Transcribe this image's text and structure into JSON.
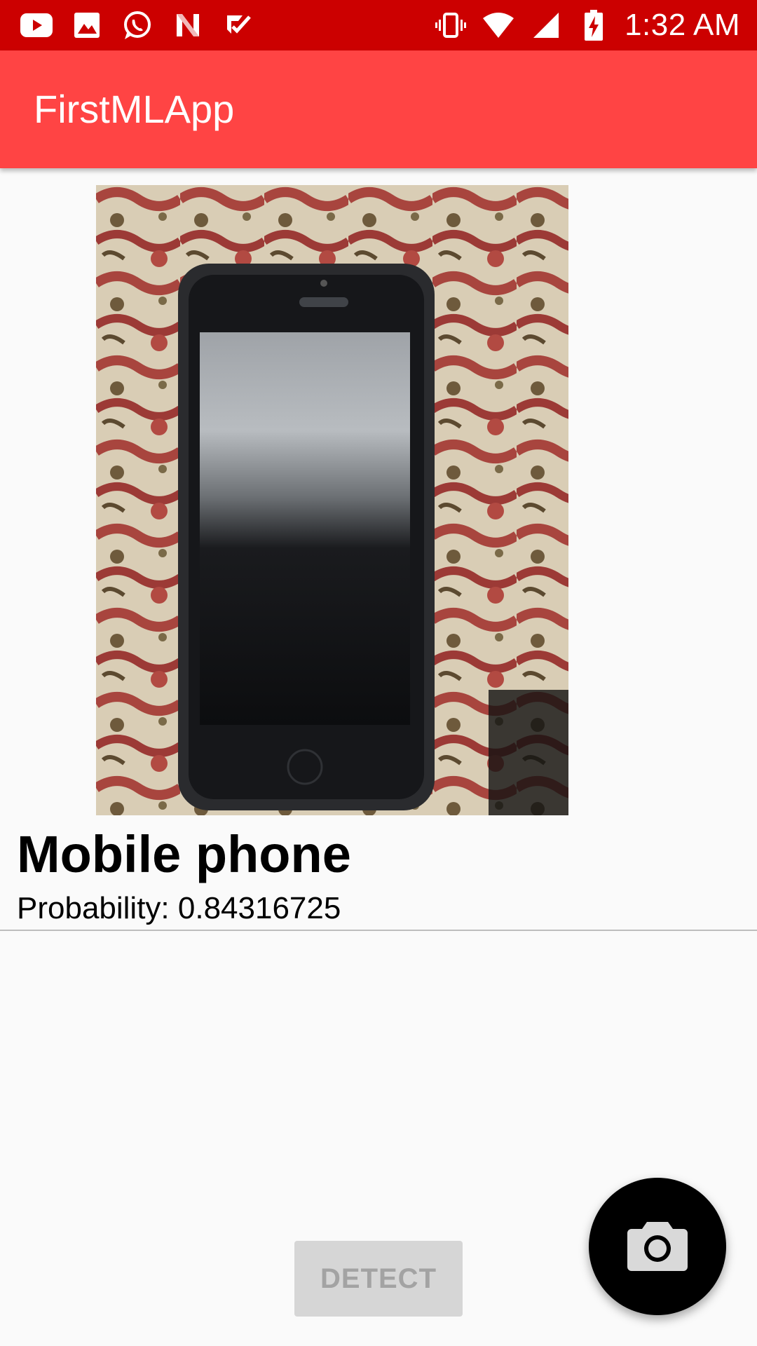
{
  "status_bar": {
    "time": "1:32 AM",
    "background": "#CC0000",
    "left_icons": [
      "youtube-icon",
      "gallery-icon",
      "whatsapp-icon",
      "netflix-icon",
      "tasks-icon"
    ],
    "right_icons": [
      "vibrate-icon",
      "wifi-icon",
      "signal-icon",
      "battery-charging-icon"
    ]
  },
  "app_bar": {
    "title": "FirstMLApp",
    "background": "#FF4444"
  },
  "main": {
    "result_label": "Mobile phone",
    "probability_text": "Probability: 0.84316725",
    "detect_label": "DETECT"
  },
  "fab": {
    "icon": "camera-icon"
  }
}
